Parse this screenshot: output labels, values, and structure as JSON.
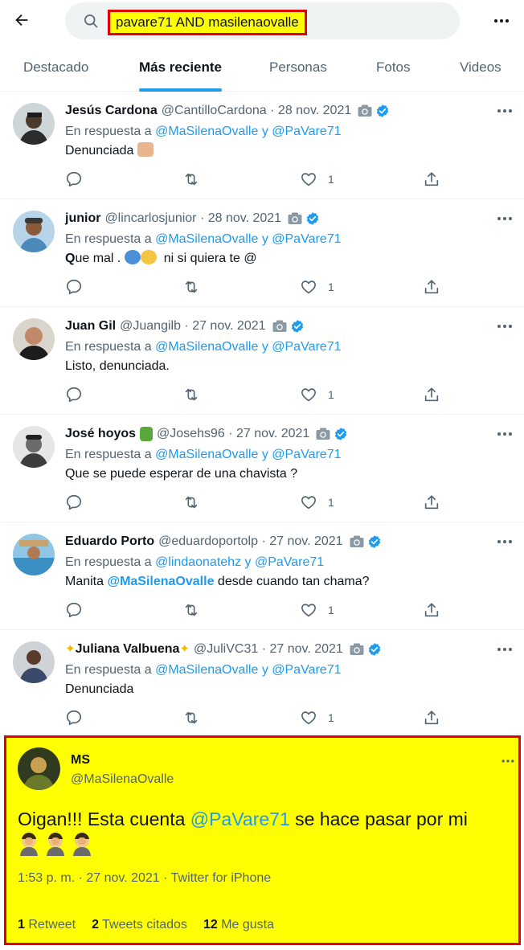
{
  "search": {
    "query": "pavare71 AND masilenaovalle"
  },
  "tabs": [
    {
      "label": "Destacado"
    },
    {
      "label": "Más reciente"
    },
    {
      "label": "Personas"
    },
    {
      "label": "Fotos"
    },
    {
      "label": "Videos"
    }
  ],
  "active_tab": "Más reciente",
  "tweets": [
    {
      "name": "Jesús Cardona",
      "meta": "@CantilloCardona · 28 nov. 2021",
      "reply_prefix": "En respuesta a",
      "reply_to": "@MaSilenaOvalle y @PaVare71",
      "text": "Denunciada",
      "likes": "1"
    },
    {
      "name": "junior",
      "meta": "@lincarlosjunior · 28 nov. 2021",
      "reply_prefix": "En respuesta a",
      "reply_to": "@MaSilenaOvalle y @PaVare71",
      "text_q": "Q",
      "text_rest": "ue mal .",
      "text_after": "ni si quiera te @",
      "likes": "1"
    },
    {
      "name": "Juan Gil",
      "meta": "@Juangilb · 27 nov. 2021",
      "reply_prefix": "En respuesta a",
      "reply_to": "@MaSilenaOvalle y @PaVare71",
      "text": "Listo, denunciada.",
      "likes": "1"
    },
    {
      "name": "José hoyos",
      "meta": "@Josehs96 · 27 nov. 2021",
      "reply_prefix": "En respuesta a",
      "reply_to": "@MaSilenaOvalle y @PaVare71",
      "text": "Que se puede esperar de una chavista ?",
      "likes": "1"
    },
    {
      "name": "Eduardo Porto",
      "meta": "@eduardoportolp · 27 nov. 2021",
      "reply_prefix": "En respuesta a",
      "reply_to": "@lindaonatehz y @PaVare71",
      "text_pre": "Manita ",
      "text_mention": "@MaSilenaOvalle",
      "text_post": " desde cuando tan chama?",
      "likes": "1"
    },
    {
      "name": "Juliana Valbuena",
      "meta": "@JuliVC31 · 27 nov. 2021",
      "reply_prefix": "En respuesta a",
      "reply_to": "@MaSilenaOvalle y @PaVare71",
      "text": "Denunciada",
      "likes": "1"
    }
  ],
  "highlight": {
    "name": "MS",
    "handle": "@MaSilenaOvalle",
    "text_pre": "Oigan!!! Esta cuenta ",
    "text_mention": "@PaVare71",
    "text_post": " se hace pasar por mi",
    "time": "1:53 p. m. · 27 nov. 2021 · Twitter for iPhone",
    "retweets_count": "1",
    "retweets_label": "Retweet",
    "quotes_count": "2",
    "quotes_label": "Tweets citados",
    "likes_count": "12",
    "likes_label": "Me gusta"
  },
  "colors": {
    "accent": "#1d9bf0",
    "highlight_bg": "#ffff00",
    "highlight_border": "#e00000",
    "verified": "#1d9bf0"
  }
}
